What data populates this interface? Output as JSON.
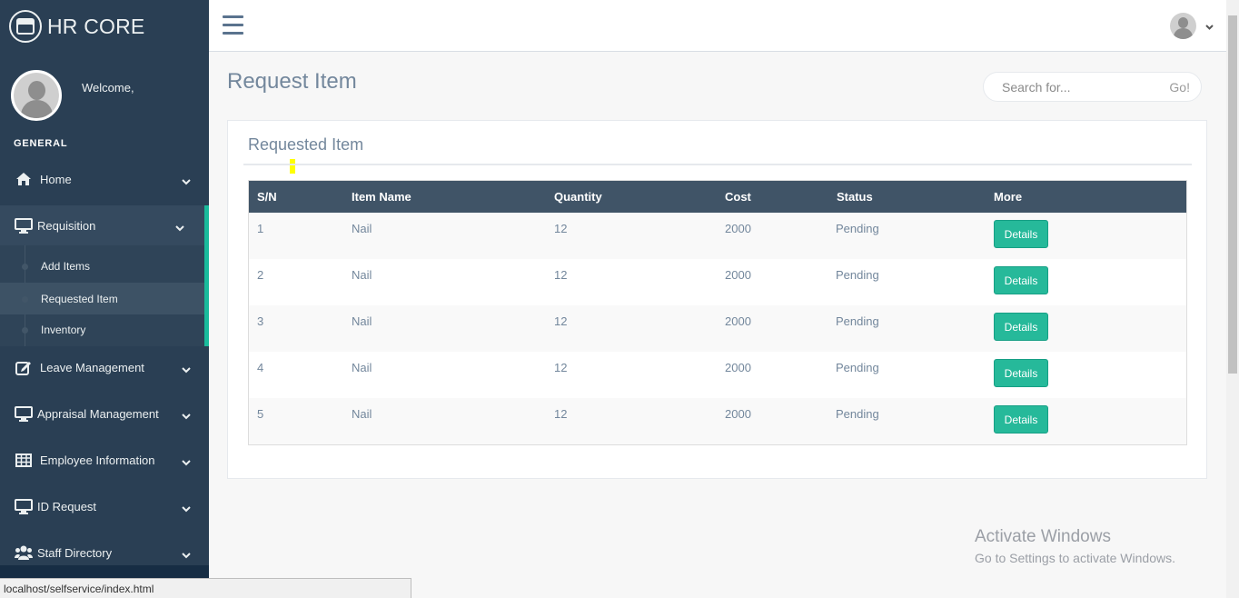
{
  "sidebar": {
    "brand": "HR CORE",
    "welcome": "Welcome,",
    "section_title": "GENERAL",
    "menu": {
      "home": "Home",
      "requisition": "Requisition",
      "leave": "Leave Management",
      "appraisal": "Appraisal Management",
      "employee": "Employee Information",
      "id_request": "ID Request",
      "staff": "Staff Directory"
    },
    "submenu": {
      "add_items": "Add Items",
      "requested_item": "Requested Item",
      "inventory": "Inventory"
    }
  },
  "header": {
    "page_title": "Request Item",
    "search_placeholder": "Search for...",
    "search_button": "Go!"
  },
  "panel": {
    "title": "Requested Item"
  },
  "table": {
    "columns": {
      "sn": "S/N",
      "item_name": "Item Name",
      "quantity": "Quantity",
      "cost": "Cost",
      "status": "Status",
      "more": "More"
    },
    "rows": [
      {
        "sn": "1",
        "item": "Nail",
        "quantity": "12",
        "cost": "2000",
        "status": "Pending",
        "action": "Details"
      },
      {
        "sn": "2",
        "item": "Nail",
        "quantity": "12",
        "cost": "2000",
        "status": "Pending",
        "action": "Details"
      },
      {
        "sn": "3",
        "item": "Nail",
        "quantity": "12",
        "cost": "2000",
        "status": "Pending",
        "action": "Details"
      },
      {
        "sn": "4",
        "item": "Nail",
        "quantity": "12",
        "cost": "2000",
        "status": "Pending",
        "action": "Details"
      },
      {
        "sn": "5",
        "item": "Nail",
        "quantity": "12",
        "cost": "2000",
        "status": "Pending",
        "action": "Details"
      }
    ]
  },
  "watermark": {
    "line1": "Activate Windows",
    "line2": "Go to Settings to activate Windows."
  },
  "statusbar": {
    "url": "localhost/selfservice/index.html"
  },
  "colors": {
    "sidebar_bg": "#2A3F54",
    "accent": "#1ABB9C",
    "table_header": "#405467",
    "details_button": "#26B99A"
  },
  "icons": [
    "hr-logo-icon",
    "home-icon",
    "monitor-icon",
    "edit-icon",
    "table-icon",
    "users-icon",
    "chevron-down-icon",
    "hamburger-icon"
  ]
}
